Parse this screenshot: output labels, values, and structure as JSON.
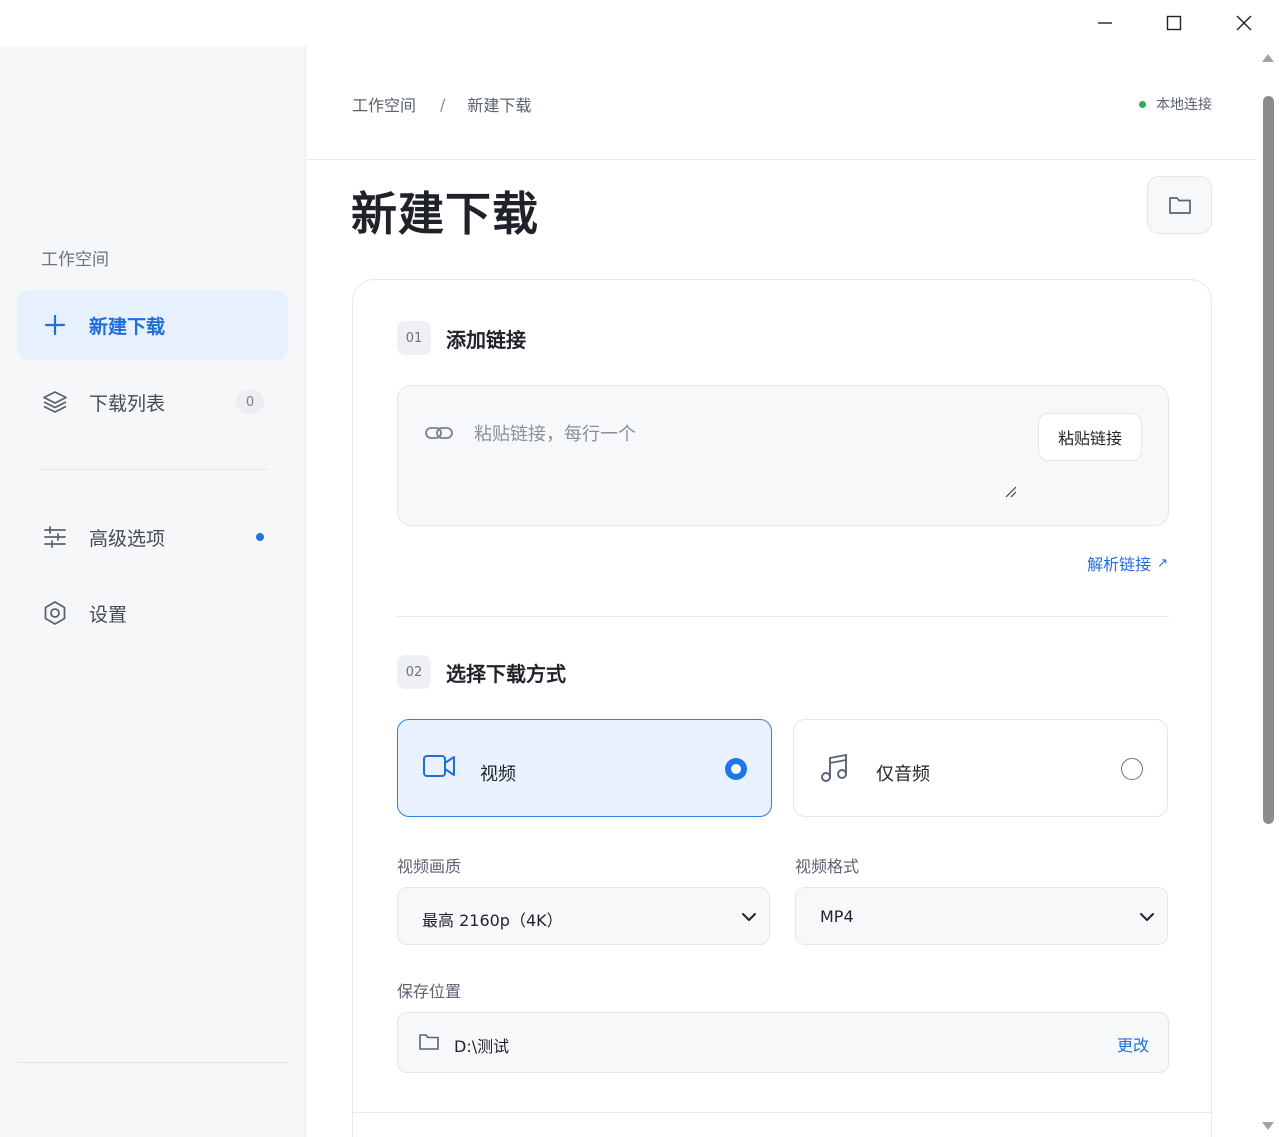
{
  "window": {
    "minimize_label": "minimize",
    "maximize_label": "maximize",
    "close_label": "close"
  },
  "sidebar": {
    "section_title": "工作空间",
    "items": [
      {
        "label": "新建下载",
        "icon": "plus-icon",
        "active": true
      },
      {
        "label": "下载列表",
        "icon": "layers-icon",
        "badge": "0"
      },
      {
        "label": "高级选项",
        "icon": "sliders-icon",
        "has_dot": true
      },
      {
        "label": "设置",
        "icon": "gear-icon"
      }
    ]
  },
  "header": {
    "breadcrumb": [
      "工作空间",
      "新建下载"
    ],
    "breadcrumb_sep": "/",
    "connection_status": "本地连接",
    "connection_color": "#27ae60"
  },
  "main": {
    "page_title": "新建下载",
    "step1": {
      "num": "01",
      "title": "添加链接",
      "placeholder": "粘贴链接，每行一个",
      "paste_button": "粘贴链接",
      "parse_link": "解析链接",
      "parse_arrow": "↗"
    },
    "step2": {
      "num": "02",
      "title": "选择下载方式",
      "modes": [
        {
          "label": "视频",
          "icon": "video-camera-icon",
          "selected": true
        },
        {
          "label": "仅音频",
          "icon": "music-note-icon",
          "selected": false
        }
      ],
      "quality_label": "视频画质",
      "quality_value": "最高 2160p（4K）",
      "format_label": "视频格式",
      "format_value": "MP4",
      "save_label": "保存位置",
      "save_path": "D:\\测试",
      "change_button": "更改"
    }
  },
  "colors": {
    "accent": "#1e77e6",
    "active_bg": "#e7f0fd",
    "sidebar_bg": "#f6f7f9"
  }
}
